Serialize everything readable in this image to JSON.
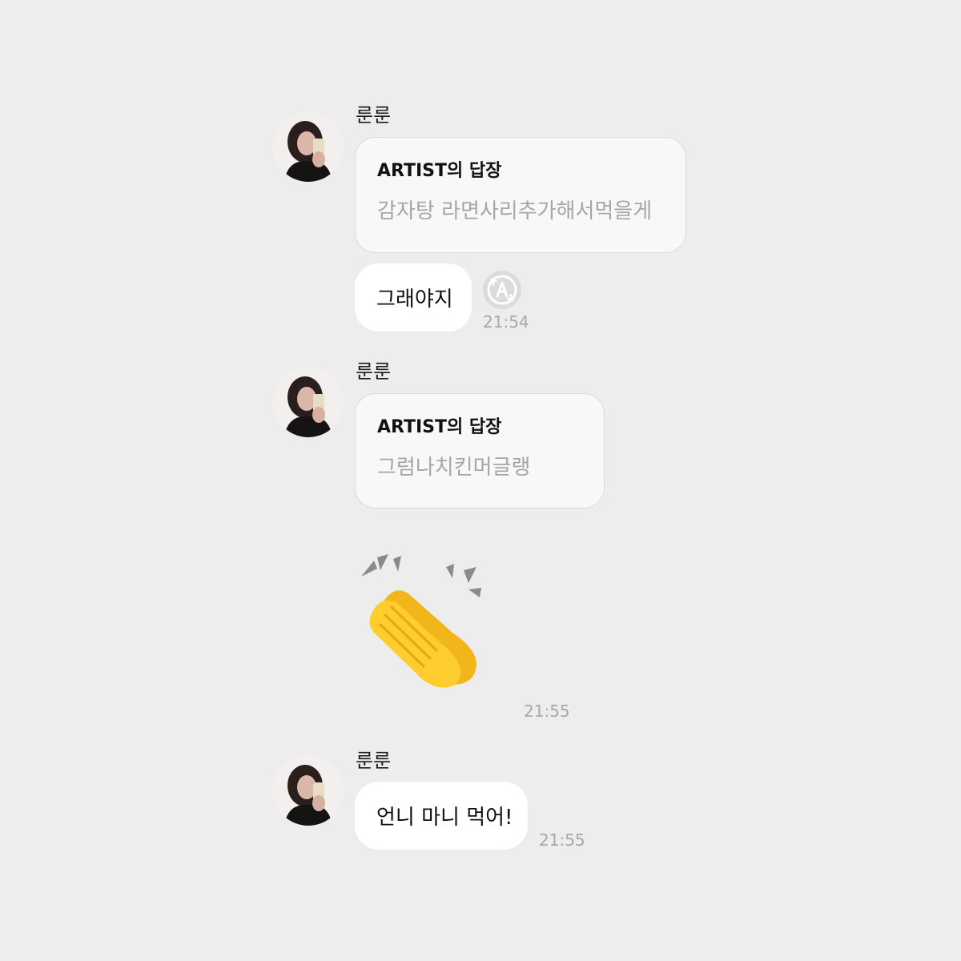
{
  "messages": [
    {
      "sender": "룬룬",
      "reply_header": "ARTIST의 답장",
      "reply_text": "감자탕 라면사리추가해서먹을게",
      "bubble_text": "그래야지",
      "time": "21:54",
      "translate_icon": "translate-icon"
    },
    {
      "sender": "룬룬",
      "reply_header": "ARTIST의 답장",
      "reply_text": "그럼나치킨머글랭"
    },
    {
      "emoji": "👏",
      "emoji_name": "clapping-hands",
      "time": "21:55"
    },
    {
      "sender": "룬룬",
      "bubble_text": "언니 마니 먹어!",
      "time": "21:55"
    }
  ],
  "colors": {
    "background": "#ededed",
    "bubble": "#ffffff",
    "reply_bubble": "#f8f8f8",
    "reply_text": "#a6a6a6",
    "timestamp": "#a8a8a8"
  }
}
